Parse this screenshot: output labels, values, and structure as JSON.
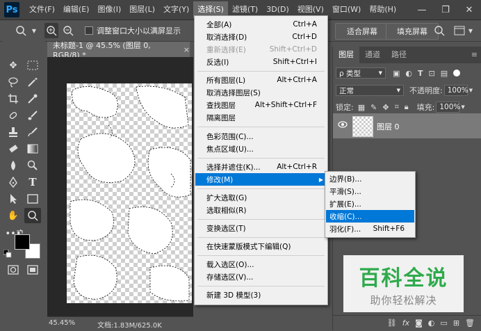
{
  "menubar": {
    "logo": "Ps",
    "items": [
      "文件(F)",
      "编辑(E)",
      "图像(I)",
      "图层(L)",
      "文字(Y)",
      "选择(S)",
      "滤镜(T)",
      "3D(D)",
      "视图(V)",
      "窗口(W)",
      "帮助(H)"
    ],
    "active_index": 5,
    "minimize": "—",
    "restore": "❐",
    "close": "✕"
  },
  "options": {
    "resize_windows_label": "调整窗口大小以满屏显示",
    "fit_screen_label": "适合屏幕",
    "fill_screen_label": "填充屏幕"
  },
  "document": {
    "tab_title": "未标题-1 @ 45.5% (图层 0, RGB/8) *",
    "tab_close": "×",
    "zoom": "45.45%",
    "doc_info": "文档:1.83M/625.0K"
  },
  "select_menu": {
    "items": [
      {
        "label": "全部(A)",
        "shortcut": "Ctrl+A",
        "disabled": false
      },
      {
        "label": "取消选择(D)",
        "shortcut": "Ctrl+D",
        "disabled": false
      },
      {
        "label": "重新选择(E)",
        "shortcut": "Shift+Ctrl+D",
        "disabled": true
      },
      {
        "label": "反选(I)",
        "shortcut": "Shift+Ctrl+I",
        "disabled": false
      },
      {
        "label": "所有图层(L)",
        "shortcut": "Alt+Ctrl+A",
        "disabled": false
      },
      {
        "label": "取消选择图层(S)",
        "shortcut": "",
        "disabled": false
      },
      {
        "label": "查找图层",
        "shortcut": "Alt+Shift+Ctrl+F",
        "disabled": false
      },
      {
        "label": "隔离图层",
        "shortcut": "",
        "disabled": false
      },
      {
        "label": "色彩范围(C)...",
        "shortcut": "",
        "disabled": false
      },
      {
        "label": "焦点区域(U)...",
        "shortcut": "",
        "disabled": false
      },
      {
        "label": "选择并遮住(K)...",
        "shortcut": "Alt+Ctrl+R",
        "disabled": false
      },
      {
        "label": "修改(M)",
        "shortcut": "",
        "disabled": false
      },
      {
        "label": "扩大选取(G)",
        "shortcut": "",
        "disabled": false
      },
      {
        "label": "选取相似(R)",
        "shortcut": "",
        "disabled": false
      },
      {
        "label": "变换选区(T)",
        "shortcut": "",
        "disabled": false
      },
      {
        "label": "在快速蒙版模式下编辑(Q)",
        "shortcut": "",
        "disabled": false
      },
      {
        "label": "载入选区(O)...",
        "shortcut": "",
        "disabled": false
      },
      {
        "label": "存储选区(V)...",
        "shortcut": "",
        "disabled": false
      },
      {
        "label": "新建 3D 模型(3)",
        "shortcut": "",
        "disabled": false
      }
    ],
    "submenu_arrow": "▶"
  },
  "modify_submenu": {
    "items": [
      {
        "label": "边界(B)...",
        "shortcut": ""
      },
      {
        "label": "平滑(S)...",
        "shortcut": ""
      },
      {
        "label": "扩展(E)...",
        "shortcut": ""
      },
      {
        "label": "收缩(C)...",
        "shortcut": ""
      },
      {
        "label": "羽化(F)...",
        "shortcut": "Shift+F6"
      }
    ],
    "highlight_index": 3
  },
  "layers_panel": {
    "tabs": [
      "图层",
      "通道",
      "路径"
    ],
    "active_tab": 0,
    "filter_label": "ρ 类型",
    "blend_mode": "正常",
    "opacity_label": "不透明度:",
    "opacity_value": "100%",
    "lock_label": "锁定:",
    "fill_label": "填充:",
    "fill_value": "100%",
    "layer_name": "图层 0",
    "fx_label": "fx"
  },
  "watermark": {
    "title": "百科全说",
    "subtitle": "助你轻松解决"
  },
  "colors": {
    "menu_highlight": "#0078d7",
    "watermark_green": "#2bb24c",
    "watermark_gray": "#8a8a8a"
  }
}
